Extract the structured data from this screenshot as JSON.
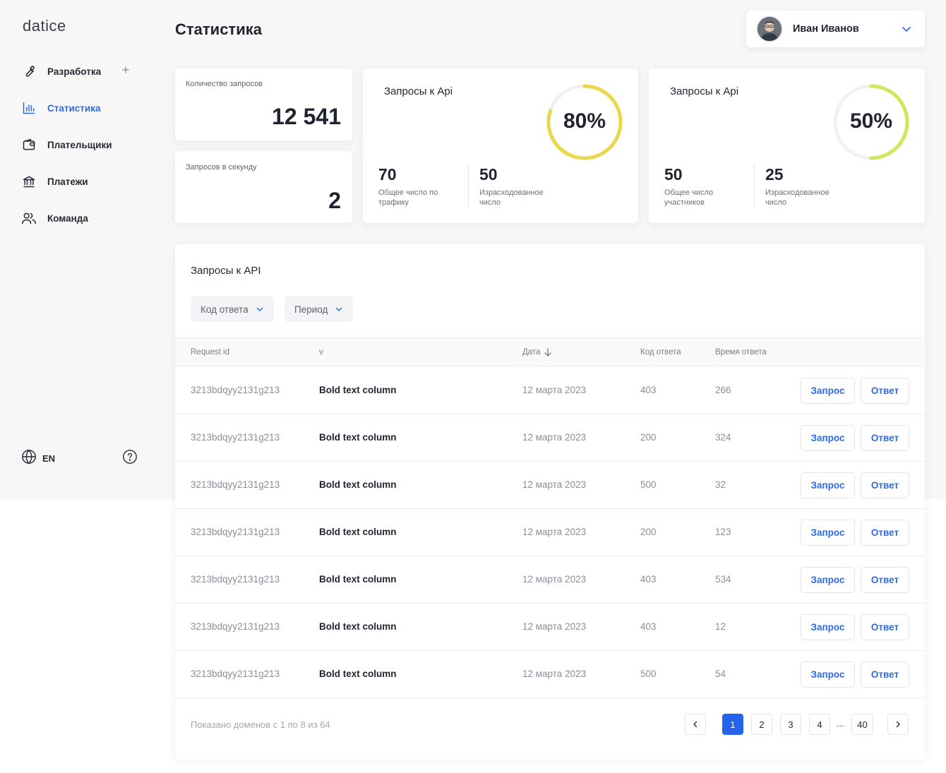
{
  "app": {
    "logo": "datice",
    "page_title": "Статистика"
  },
  "sidebar": {
    "items": [
      {
        "label": "Разработка",
        "icon": "wrench-icon"
      },
      {
        "label": "Статистика",
        "icon": "bar-chart-icon",
        "active": true
      },
      {
        "label": "Плательщики",
        "icon": "wallet-icon"
      },
      {
        "label": "Платежи",
        "icon": "bank-icon"
      },
      {
        "label": "Команда",
        "icon": "users-icon"
      }
    ],
    "language": "EN"
  },
  "user": {
    "name": "Иван Иванов"
  },
  "stats": {
    "requests_count": {
      "label": "Количество запросов",
      "value": "12 541"
    },
    "requests_per_second": {
      "label": "Запросов в секунду",
      "value": "2"
    },
    "api_card_1": {
      "title": "Запросы к Api",
      "percent": 80,
      "percent_label": "80%",
      "color": "#e8d84a",
      "left_value": "70",
      "left_label": "Общее число по трафику",
      "right_value": "50",
      "right_label": "Израсходованное число"
    },
    "api_card_2": {
      "title": "Запросы к Api",
      "percent": 50,
      "percent_label": "50%",
      "color": "#cde85a",
      "left_value": "50",
      "left_label": "Общее число участников",
      "right_value": "25",
      "right_label": "Израсходованное число"
    }
  },
  "table": {
    "title": "Запросы к API",
    "filters": [
      "Код ответа",
      "Период"
    ],
    "columns": [
      "Request id",
      "v",
      "Дата",
      "Код ответа",
      "Время ответа"
    ],
    "request_button": "Запрос",
    "response_button": "Ответ",
    "rows": [
      {
        "id": "3213bdqyy2131g213",
        "v": "Bold text column",
        "date": "12 марта 2023",
        "code": "403",
        "time": "266"
      },
      {
        "id": "3213bdqyy2131g213",
        "v": "Bold text column",
        "date": "12 марта 2023",
        "code": "200",
        "time": "324"
      },
      {
        "id": "3213bdqyy2131g213",
        "v": "Bold text column",
        "date": "12 марта 2023",
        "code": "500",
        "time": "32"
      },
      {
        "id": "3213bdqyy2131g213",
        "v": "Bold text column",
        "date": "12 марта 2023",
        "code": "200",
        "time": "123"
      },
      {
        "id": "3213bdqyy2131g213",
        "v": "Bold text column",
        "date": "12 марта 2023",
        "code": "403",
        "time": "534"
      },
      {
        "id": "3213bdqyy2131g213",
        "v": "Bold text column",
        "date": "12 марта 2023",
        "code": "403",
        "time": "12"
      },
      {
        "id": "3213bdqyy2131g213",
        "v": "Bold text column",
        "date": "12 марта 2023",
        "code": "500",
        "time": "54"
      }
    ],
    "footer": "Показано доменов с 1 по 8 из  64",
    "pagination": {
      "pages": [
        "1",
        "2",
        "3",
        "4"
      ],
      "ellipsis": "...",
      "last": "40",
      "current": "1"
    }
  }
}
